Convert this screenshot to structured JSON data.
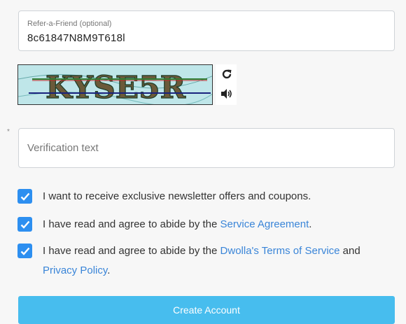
{
  "referral": {
    "label": "Refer-a-Friend (optional)",
    "value": "8c61847N8M9T618l"
  },
  "captcha": {
    "image_text": "KYSE5R",
    "refresh_icon": "refresh-icon",
    "audio_icon": "speaker-icon"
  },
  "verification": {
    "required_marker": "*",
    "placeholder": "Verification text",
    "value": ""
  },
  "checkboxes": [
    {
      "checked": true,
      "text": "I want to receive exclusive newsletter offers and coupons."
    },
    {
      "checked": true,
      "text_before": "I have read and agree to abide by the ",
      "link": "Service Agreement",
      "text_after": "."
    },
    {
      "checked": true,
      "text_before": "I have read and agree to abide by the ",
      "link": "Dwolla's Terms of Service",
      "text_mid": " and ",
      "link2": "Privacy Policy",
      "text_after": "."
    }
  ],
  "submit": {
    "label": "Create Account"
  },
  "colors": {
    "checkbox": "#2d8ff0",
    "link": "#3a85d8",
    "button": "#47bdee",
    "captcha_bg": "#bfe6e9"
  }
}
